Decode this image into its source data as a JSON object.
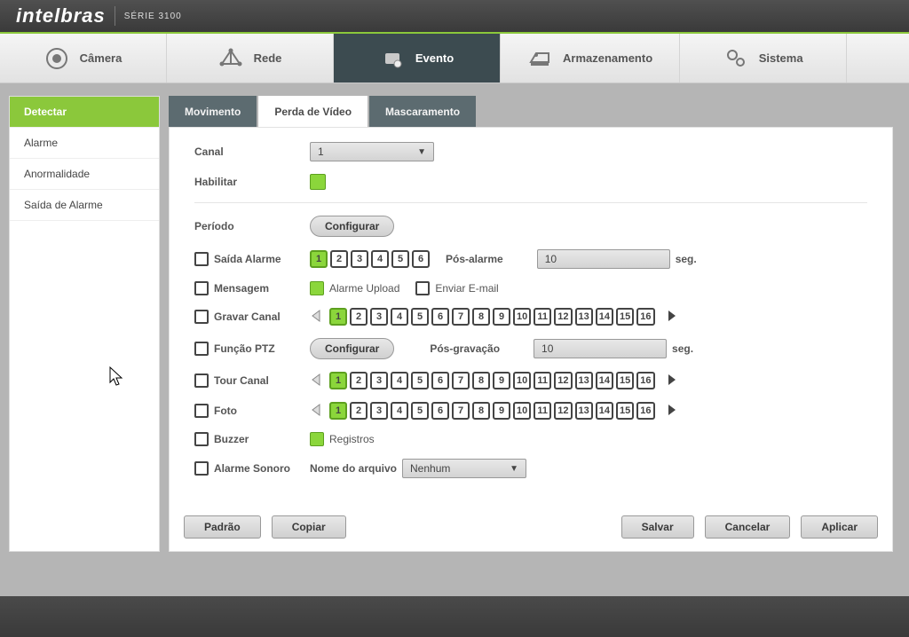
{
  "top": {
    "brand": "intelbras",
    "serie": "SÉRIE 3100"
  },
  "nav": {
    "camera": "Câmera",
    "rede": "Rede",
    "evento": "Evento",
    "armaz": "Armazenamento",
    "sistema": "Sistema"
  },
  "sidebar": {
    "detectar": "Detectar",
    "alarme": "Alarme",
    "anormal": "Anormalidade",
    "saida": "Saída de Alarme"
  },
  "tabs": {
    "mov": "Movimento",
    "perda": "Perda de Vídeo",
    "masc": "Mascaramento"
  },
  "labels": {
    "canal": "Canal",
    "canal_value": "1",
    "habilitar": "Habilitar",
    "periodo": "Período",
    "configurar": "Configurar",
    "saida_alarme": "Saída Alarme",
    "pos_alarme": "Pós-alarme",
    "pos_alarme_val": "10",
    "seg": "seg.",
    "mensagem": "Mensagem",
    "alarme_upload": "Alarme Upload",
    "enviar_email": "Enviar E-mail",
    "gravar_canal": "Gravar Canal",
    "funcao_ptz": "Função PTZ",
    "pos_gravacao": "Pós-gravação",
    "pos_gravacao_val": "10",
    "tour_canal": "Tour Canal",
    "foto": "Foto",
    "buzzer": "Buzzer",
    "registros": "Registros",
    "alarme_sonoro": "Alarme Sonoro",
    "nome_arquivo": "Nome do arquivo",
    "nenhum": "Nenhum"
  },
  "alarm_outputs": [
    "1",
    "2",
    "3",
    "4",
    "5",
    "6"
  ],
  "channels": [
    "1",
    "2",
    "3",
    "4",
    "5",
    "6",
    "7",
    "8",
    "9",
    "10",
    "11",
    "12",
    "13",
    "14",
    "15",
    "16"
  ],
  "channel_selected": "1",
  "footer": {
    "padrao": "Padrão",
    "copiar": "Copiar",
    "salvar": "Salvar",
    "cancelar": "Cancelar",
    "aplicar": "Aplicar"
  }
}
